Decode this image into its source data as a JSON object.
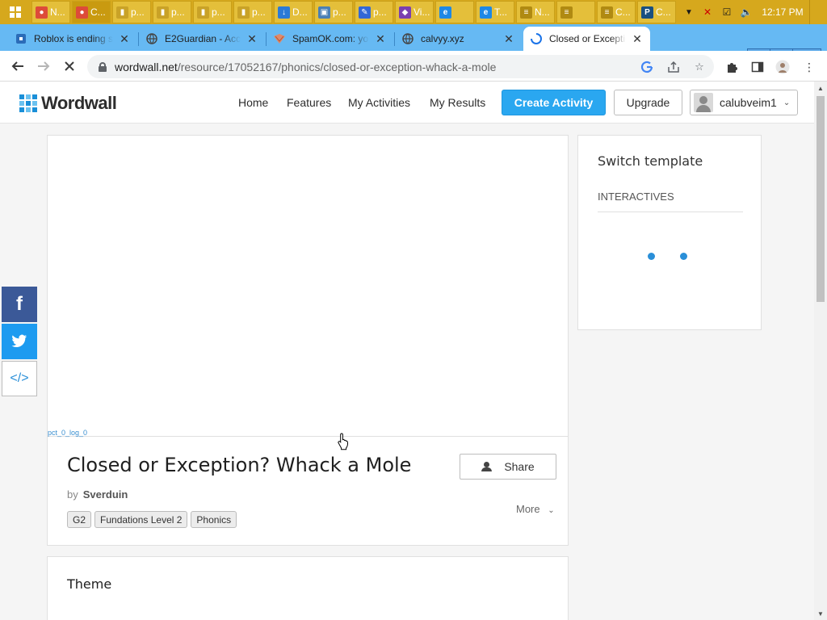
{
  "taskbar": {
    "items": [
      {
        "label": "N...",
        "icon": "chrome-icon"
      },
      {
        "label": "C...",
        "icon": "chrome-icon"
      },
      {
        "label": "p...",
        "icon": "document-icon"
      },
      {
        "label": "p...",
        "icon": "document-icon"
      },
      {
        "label": "p...",
        "icon": "document-icon"
      },
      {
        "label": "p...",
        "icon": "document-icon"
      },
      {
        "label": "D...",
        "icon": "download-icon"
      },
      {
        "label": "p...",
        "icon": "photo-icon"
      },
      {
        "label": "p...",
        "icon": "paint-icon"
      },
      {
        "label": "Vi...",
        "icon": "visual-studio-icon"
      },
      {
        "label": "",
        "icon": "edge-icon"
      },
      {
        "label": "T...",
        "icon": "edge-icon"
      },
      {
        "label": "N...",
        "icon": "notes-icon"
      },
      {
        "label": "",
        "icon": "notes-icon"
      },
      {
        "label": "C...",
        "icon": "notes-icon"
      },
      {
        "label": "C...",
        "icon": "photoshop-icon"
      }
    ],
    "time": "12:17 PM"
  },
  "tabs": [
    {
      "title": "Roblox is ending s",
      "favicon": "roblox-icon"
    },
    {
      "title": "E2Guardian - Acce",
      "favicon": "globe-icon"
    },
    {
      "title": "SpamOK.com: yo",
      "favicon": "spamok-icon"
    },
    {
      "title": "calvyy.xyz",
      "favicon": "globe-icon"
    },
    {
      "title": "Closed or Exception",
      "favicon": "loading-icon"
    }
  ],
  "address_bar": {
    "host": "wordwall.net",
    "path": "/resource/17052167/phonics/closed-or-exception-whack-a-mole"
  },
  "site": {
    "brand": "Wordwall",
    "nav": {
      "home": "Home",
      "features": "Features",
      "my_activities": "My Activities",
      "my_results": "My Results"
    },
    "create_activity": "Create Activity",
    "upgrade": "Upgrade",
    "username": "calubveim1"
  },
  "activity": {
    "debug_text": "pct_0_log_0",
    "title": "Closed or Exception? Whack a Mole",
    "by_prefix": "by",
    "author": "Sverduin",
    "tags": [
      "G2",
      "Fundations Level 2",
      "Phonics"
    ],
    "share": "Share",
    "more": "More"
  },
  "theme": {
    "title": "Theme"
  },
  "sidebar": {
    "title": "Switch template",
    "section": "INTERACTIVES"
  },
  "colors": {
    "accent": "#2aa7f0",
    "facebook": "#3b5998",
    "twitter": "#1d9bf0",
    "taskbar": "#d6a81d",
    "tabstrip": "#66b9f3"
  }
}
